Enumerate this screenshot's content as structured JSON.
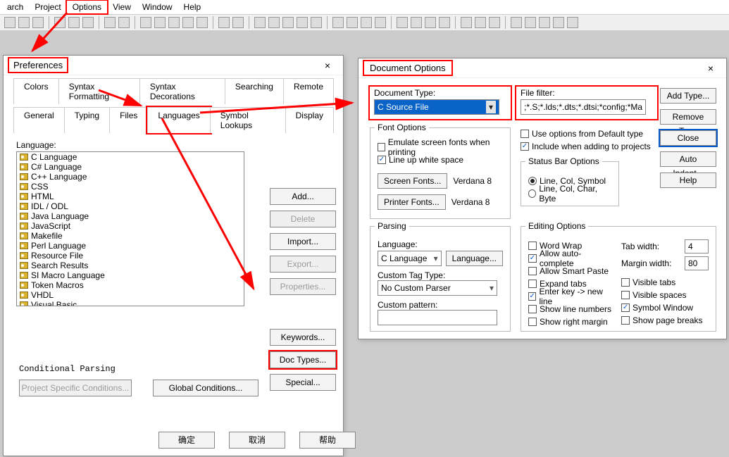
{
  "menu": {
    "search": "arch",
    "project": "Project",
    "options": "Options",
    "view": "View",
    "window": "Window",
    "help": "Help"
  },
  "pref": {
    "title": "Preferences",
    "tabs1": [
      "Colors",
      "Syntax Formatting",
      "Syntax Decorations",
      "Searching",
      "Remote"
    ],
    "tabs2": [
      "General",
      "Typing",
      "Files",
      "Languages",
      "Symbol Lookups",
      "Display"
    ],
    "language_label": "Language:",
    "langs": [
      "C Language",
      "C# Language",
      "C++ Language",
      "CSS",
      "HTML",
      "IDL / ODL",
      "Java Language",
      "JavaScript",
      "Makefile",
      "Perl Language",
      "Resource File",
      "Search Results",
      "SI Macro Language",
      "Token Macros",
      "VHDL",
      "Visual Basic"
    ],
    "side": {
      "add": "Add...",
      "delete": "Delete",
      "import": "Import...",
      "export": "Export...",
      "properties": "Properties...",
      "keywords": "Keywords...",
      "doctypes": "Doc Types...",
      "special": "Special..."
    },
    "cond_label": "Conditional Parsing",
    "proj_cond": "Project Specific Conditions...",
    "glob_cond": "Global Conditions...",
    "ok": "确定",
    "cancel": "取消",
    "help": "帮助"
  },
  "doc": {
    "title": "Document Options",
    "doctype_label": "Document Type:",
    "doctype_value": "C Source File",
    "filter_label": "File filter:",
    "filter_value": ";*.S;*.lds;*.dts;*.dtsi;*config;*Makefile;",
    "font": {
      "legend": "Font Options",
      "emulate": "Emulate screen fonts when printing",
      "lineup": "Line up white space",
      "screen_btn": "Screen Fonts...",
      "printer_btn": "Printer Fonts...",
      "screen_val": "Verdana 8",
      "printer_val": "Verdana 8"
    },
    "parse": {
      "legend": "Parsing",
      "language_label": "Language:",
      "language": "C Language",
      "lang_btn": "Language...",
      "tagtype_label": "Custom Tag Type:",
      "tagtype": "No Custom Parser",
      "pattern_label": "Custom pattern:"
    },
    "opts": {
      "use_default": "Use options from Default type",
      "include_add": "Include when adding to projects"
    },
    "status": {
      "legend": "Status Bar Options",
      "r1": "Line, Col, Symbol",
      "r2": "Line, Col, Char, Byte"
    },
    "edit": {
      "legend": "Editing Options",
      "wordwrap": "Word Wrap",
      "autocomplete": "Allow auto-complete",
      "smartpaste": "Allow Smart Paste",
      "expand": "Expand tabs",
      "enterkey": "Enter key -> new line",
      "linenum": "Show line numbers",
      "margin": "Show right margin",
      "tabwidth_label": "Tab width:",
      "tabwidth": "4",
      "marginwidth_label": "Margin width:",
      "marginwidth": "80",
      "vistabs": "Visible tabs",
      "visspaces": "Visible spaces",
      "symwin": "Symbol Window",
      "pagebreaks": "Show page breaks"
    },
    "rbtns": {
      "add": "Add Type...",
      "remove": "Remove Type",
      "close": "Close",
      "indent": "Auto Indent...",
      "help": "Help"
    }
  }
}
